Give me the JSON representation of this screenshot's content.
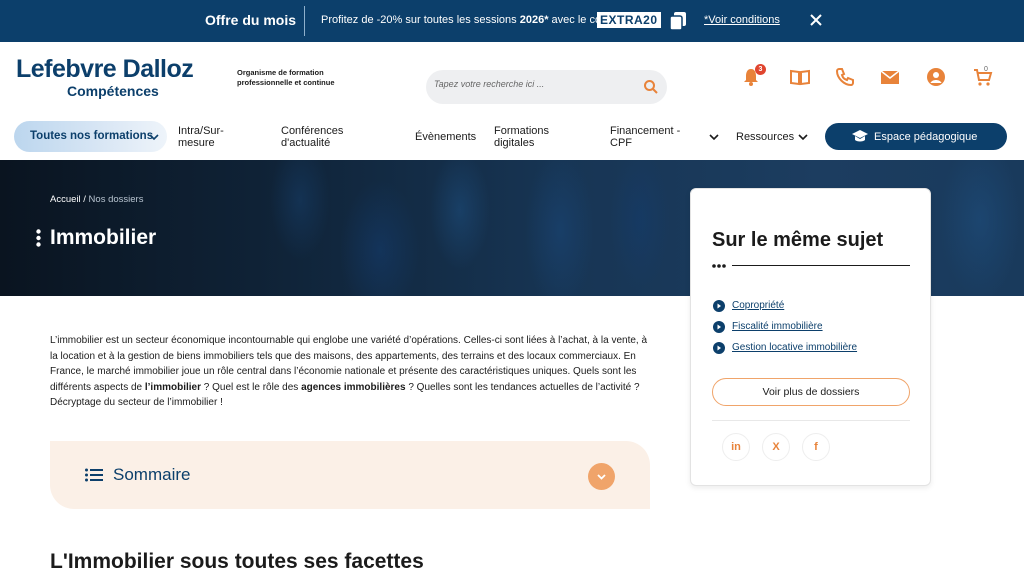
{
  "promo": {
    "title": "Offre du mois",
    "text_before": "Profitez de -20% sur toutes les sessions ",
    "year": "2026*",
    "text_after": " avec le code",
    "code": "EXTRA20",
    "link": "*Voir conditions"
  },
  "header": {
    "logo_main": "Lefebvre Dalloz",
    "logo_sub": "Compétences",
    "tagline": "Organisme de formation professionnelle et continue",
    "search_placeholder": "Tapez votre recherche ici ...",
    "notifications_count": "3",
    "cart_count": "0",
    "colors": {
      "brand": "#0c3f6b",
      "accent": "#e8833a"
    }
  },
  "nav": {
    "all": "Toutes nos formations",
    "intra": "Intra/Sur-mesure",
    "conferences": "Conférences d'actualité",
    "evenements": "Évènements",
    "digitales": "Formations digitales",
    "financement": "Financement - CPF",
    "ressources": "Ressources",
    "cta": "Espace pédagogique"
  },
  "hero": {
    "breadcrumb_home": "Accueil",
    "breadcrumb_sep": " / ",
    "breadcrumb_current": "Nos dossiers",
    "title": "Immobilier"
  },
  "side": {
    "title": "Sur le même sujet",
    "links": [
      "Copropriété",
      "Fiscalité immobilière",
      "Gestion locative immobilière"
    ],
    "button": "Voir plus de dossiers",
    "social": [
      "in",
      "X",
      "f"
    ]
  },
  "intro": {
    "p1": "L’immobilier est un secteur économique incontournable qui englobe une variété d’opérations. Celles-ci sont liées à l’achat, à la vente, à la location et à la gestion de biens immobiliers tels que des maisons, des appartements, des terrains et des locaux commerciaux. En France, le marché immobilier joue un rôle central dans l’économie nationale et présente des caractéristiques uniques. Quels sont les différents aspects de ",
    "b1": "l’immobilier",
    "p2": " ? Quel est le rôle des ",
    "b2": "agences immobilières",
    "p3": " ? Quelles sont les tendances actuelles de l’activité ? Décryptage du secteur de l’immobilier !"
  },
  "sommaire": {
    "label": "Sommaire"
  },
  "section": {
    "title": "L'Immobilier sous toutes ses facettes"
  }
}
